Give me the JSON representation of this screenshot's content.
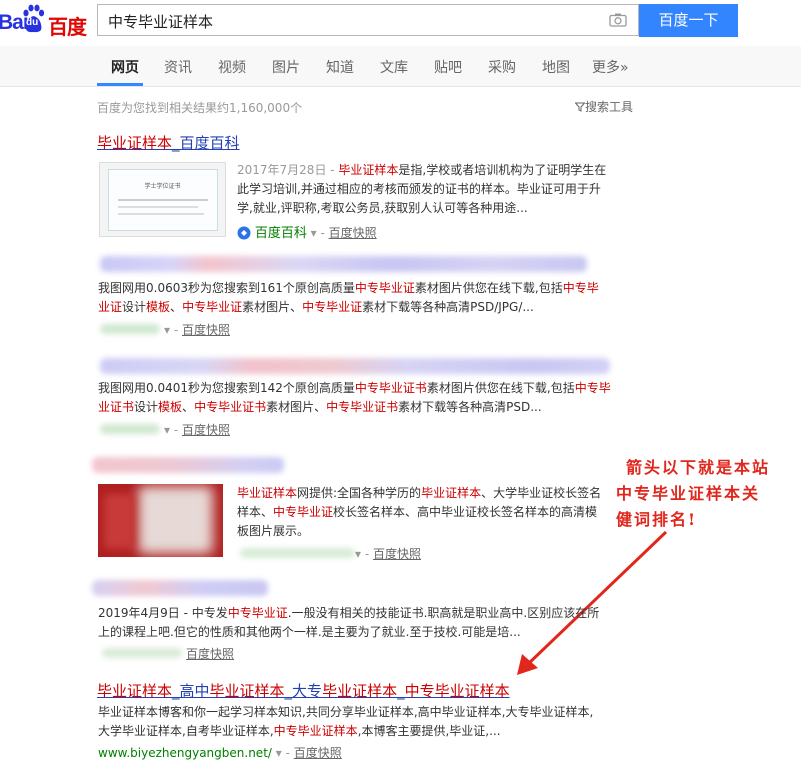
{
  "logo": {
    "bai": "Bai",
    "du": "du",
    "baidu": "百度"
  },
  "search": {
    "query": "中专毕业证样本",
    "button": "百度一下"
  },
  "nav": {
    "tabs": [
      "网页",
      "资讯",
      "视频",
      "图片",
      "知道",
      "文库",
      "贴吧",
      "采购",
      "地图",
      "更多»"
    ]
  },
  "result_count": "百度为您找到相关结果约1,160,000个",
  "search_tools": "搜索工具",
  "results": [
    {
      "title_a": "毕业证样本",
      "title_b": "_百度百科",
      "date": "2017年7月28日 - ",
      "line1_em": "毕业证样本",
      "line1_rest": "是指,学校或者培训机构为了证明学生在",
      "line2": "此学习培训,并通过相应的考核而颁发的证书的样本。毕业证可用于升",
      "line3": "学,就业,评职称,考取公务员,获取别人认可等各种用途...",
      "source": "百度百科",
      "cache": "百度快照",
      "thumb_text": "学士学位证书"
    },
    {
      "line1_a": "我图网用0.0603秒为您搜索到161个原创高质量",
      "line1_em1": "中专毕业证",
      "line1_b": "素材图片供您在线下载,包括",
      "line1_em2": "中专毕",
      "line2_em1": "业证",
      "line2_a": "设计",
      "line2_em2": "模板",
      "line2_b": "、",
      "line2_em3": "中专毕业证",
      "line2_c": "素材图片、",
      "line2_em4": "中专毕业证",
      "line2_d": "素材下载等各种高清PSD/JPG/...",
      "cache": "百度快照"
    },
    {
      "line1_a": "我图网用0.0401秒为您搜索到142个原创高质量",
      "line1_em1": "中专毕业证书",
      "line1_b": "素材图片供您在线下载,包括",
      "line1_em2": "中专毕",
      "line2_em1": "业证书",
      "line2_a": "设计",
      "line2_em2": "模板",
      "line2_b": "、",
      "line2_em3": "中专毕业证书",
      "line2_c": "素材图片、",
      "line2_em4": "中专毕业证书",
      "line2_d": "素材下载等各种高清PSD...",
      "cache": "百度快照"
    },
    {
      "line1_em1": "毕业证样本",
      "line1_a": "网提供:全国各种学历的",
      "line1_em2": "毕业证样本",
      "line1_b": "、大学毕业证校长签名",
      "line2_a": "样本、",
      "line2_em1": "中专毕业证",
      "line2_b": "校长签名样本、高中毕业证校长签名样本的高清模",
      "line3": "板图片展示。",
      "cache": "百度快照"
    },
    {
      "line1_a": "2019年4月9日 - 中专发",
      "line1_em": "中专毕业证",
      "line1_b": ".一般没有相关的技能证书.职高就是职业高中.区别应该在所",
      "line2": "上的课程上吧.但它的性质和其他两个一样.是主要为了就业.至于技校.可能是培...",
      "cache": "百度快照"
    },
    {
      "title_e1": "毕业证样本",
      "title_s1": "_高中",
      "title_e2": "毕业证样本",
      "title_s2": "_大专",
      "title_e3": "毕业证样本",
      "title_s3": "_",
      "title_e4": "中专毕业证样本",
      "line1": "毕业证样本博客和你一起学习样本知识,共同分享毕业证样本,高中毕业证样本,大专毕业证样本,",
      "line2_a": "大学毕业证样本,自考毕业证样本,",
      "line2_em": "中专毕业证样本",
      "line2_b": ",本博客主要提供,毕业证,...",
      "url": "www.biyezhengyangben.net/",
      "cache": "百度快照"
    }
  ],
  "annotation": {
    "line1": "箭头以下就是本站",
    "line2": "中专毕业证样本关",
    "line3": "健词排名!"
  },
  "colors": {
    "accent": "#3385ff",
    "link": "#2440b3",
    "highlight": "#cc0000",
    "annotation": "#e1261c"
  }
}
